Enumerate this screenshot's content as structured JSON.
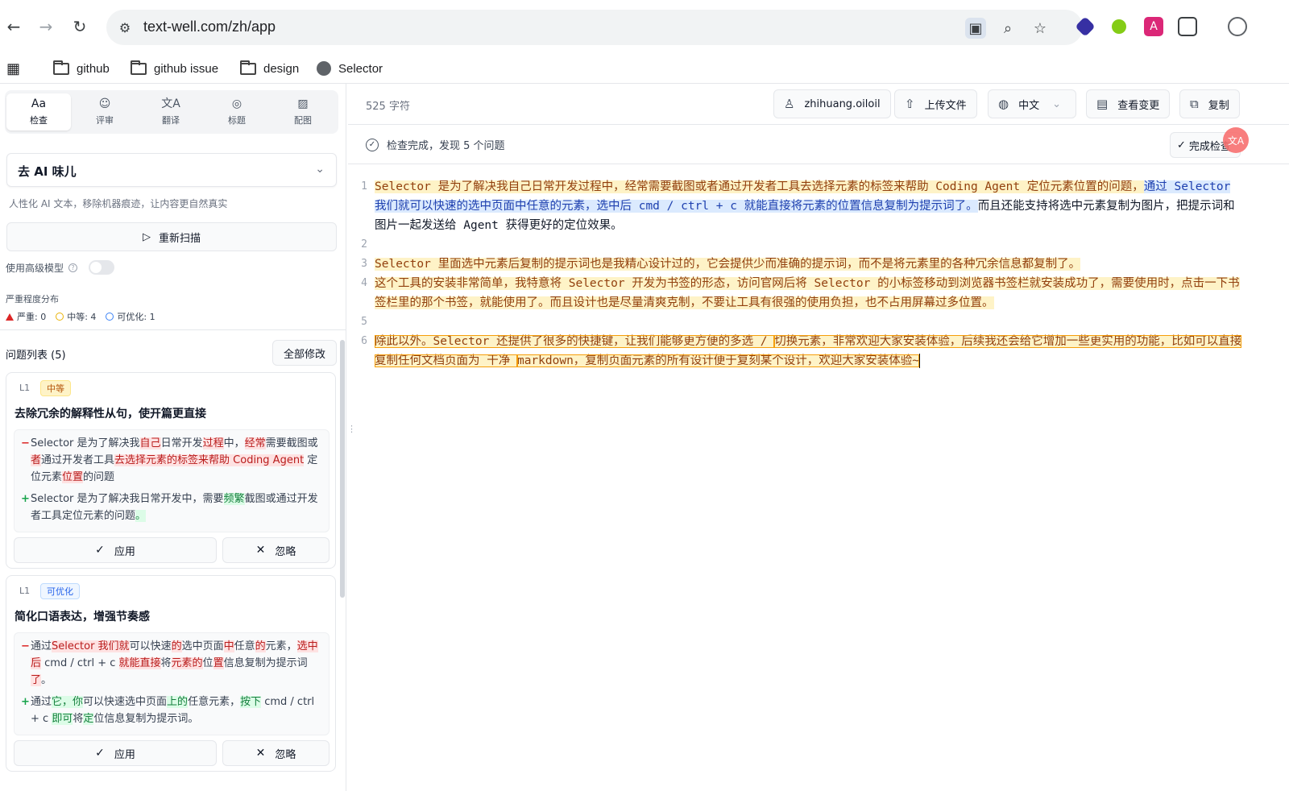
{
  "browser": {
    "url": "text-well.com/zh/app",
    "bookmarks": [
      "github",
      "github issue",
      "design",
      "Selector"
    ]
  },
  "sidebar": {
    "tabs": [
      {
        "label": "检查",
        "icon": "check-text-icon",
        "active": true
      },
      {
        "label": "评审",
        "icon": "users-icon",
        "active": false
      },
      {
        "label": "翻译",
        "icon": "translate-icon",
        "active": false
      },
      {
        "label": "标题",
        "icon": "palette-icon",
        "active": false
      },
      {
        "label": "配图",
        "icon": "image-icon",
        "active": false
      }
    ],
    "mode": "去 AI 味儿",
    "mode_desc": "人性化 AI 文本，移除机器痕迹，让内容更自然真实",
    "rescan_label": "重新扫描",
    "advanced_label": "使用高级模型",
    "advanced_enabled": false,
    "severity_title": "严重程度分布",
    "severity": {
      "high": "严重: 0",
      "medium": "中等: 4",
      "low": "可优化: 1"
    },
    "issue_list_title": "问题列表 (5)",
    "fix_all_label": "全部修改",
    "issues": [
      {
        "level": "L1",
        "badge": "中等",
        "title": "去除冗余的解释性从句，使开篇更直接",
        "apply": "应用",
        "ignore": "忽略"
      },
      {
        "level": "L1",
        "badge": "可优化",
        "title": "简化口语表达，增强节奏感",
        "apply": "应用",
        "ignore": "忽略"
      }
    ]
  },
  "main": {
    "char_count": "525 字符",
    "user": "zhihuang.oiloil",
    "upload_label": "上传文件",
    "language": "中文",
    "view_changes_label": "查看变更",
    "copy_label": "复制",
    "status_text": "检查完成，发现 5 个问题",
    "done_label": "完成检查",
    "line_numbers": [
      "1",
      "2",
      "3",
      "4",
      "5",
      "6"
    ]
  },
  "colors": {
    "accent": "#2563eb",
    "issue_medium": "#fef3c7",
    "issue_blue": "#dbeafe",
    "delete": "#fee2e2",
    "insert": "#dcfce7"
  }
}
